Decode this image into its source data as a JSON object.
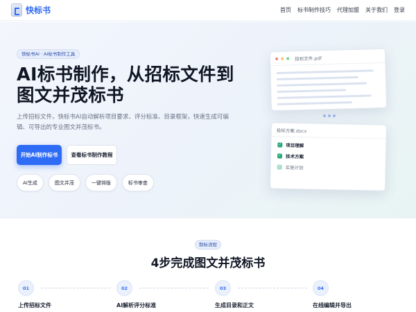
{
  "header": {
    "brand": "快标书",
    "nav": [
      "首页",
      "标书制作技巧",
      "代理加盟",
      "关于我们",
      "登录"
    ]
  },
  "hero": {
    "tag": "快标书AI · AI标书制作工具",
    "headline": "AI标书制作，从招标文件到图文并茂标书",
    "subtitle": "上传招标文件，快标书AI自动解析项目要求、评分标准、目录框架，快速生成可编辑、可导出的专业图文并茂标书。",
    "primary_button": "开始AI制作标书",
    "secondary_button": "查看标书制作教程",
    "chips": [
      "AI生成",
      "图文并茂",
      "一键排版",
      "标书审查"
    ]
  },
  "illustration": {
    "pdf_title": "招标文件.pdf",
    "doc_title": "投标方案.docx",
    "tasks": [
      {
        "label": "项目理解",
        "done": true
      },
      {
        "label": "技术方案",
        "done": true
      },
      {
        "label": "实施计划",
        "done": false
      }
    ]
  },
  "process": {
    "badge": "制标流程",
    "title": "4步完成图文并茂标书",
    "steps": [
      {
        "num": "01",
        "label": "上传招标文件"
      },
      {
        "num": "02",
        "label": "AI解析评分标准"
      },
      {
        "num": "03",
        "label": "生成目录和正文"
      },
      {
        "num": "04",
        "label": "在线编辑并导出"
      }
    ]
  },
  "colors": {
    "accent": "#2f6cf6",
    "done": "#2aa87a"
  }
}
